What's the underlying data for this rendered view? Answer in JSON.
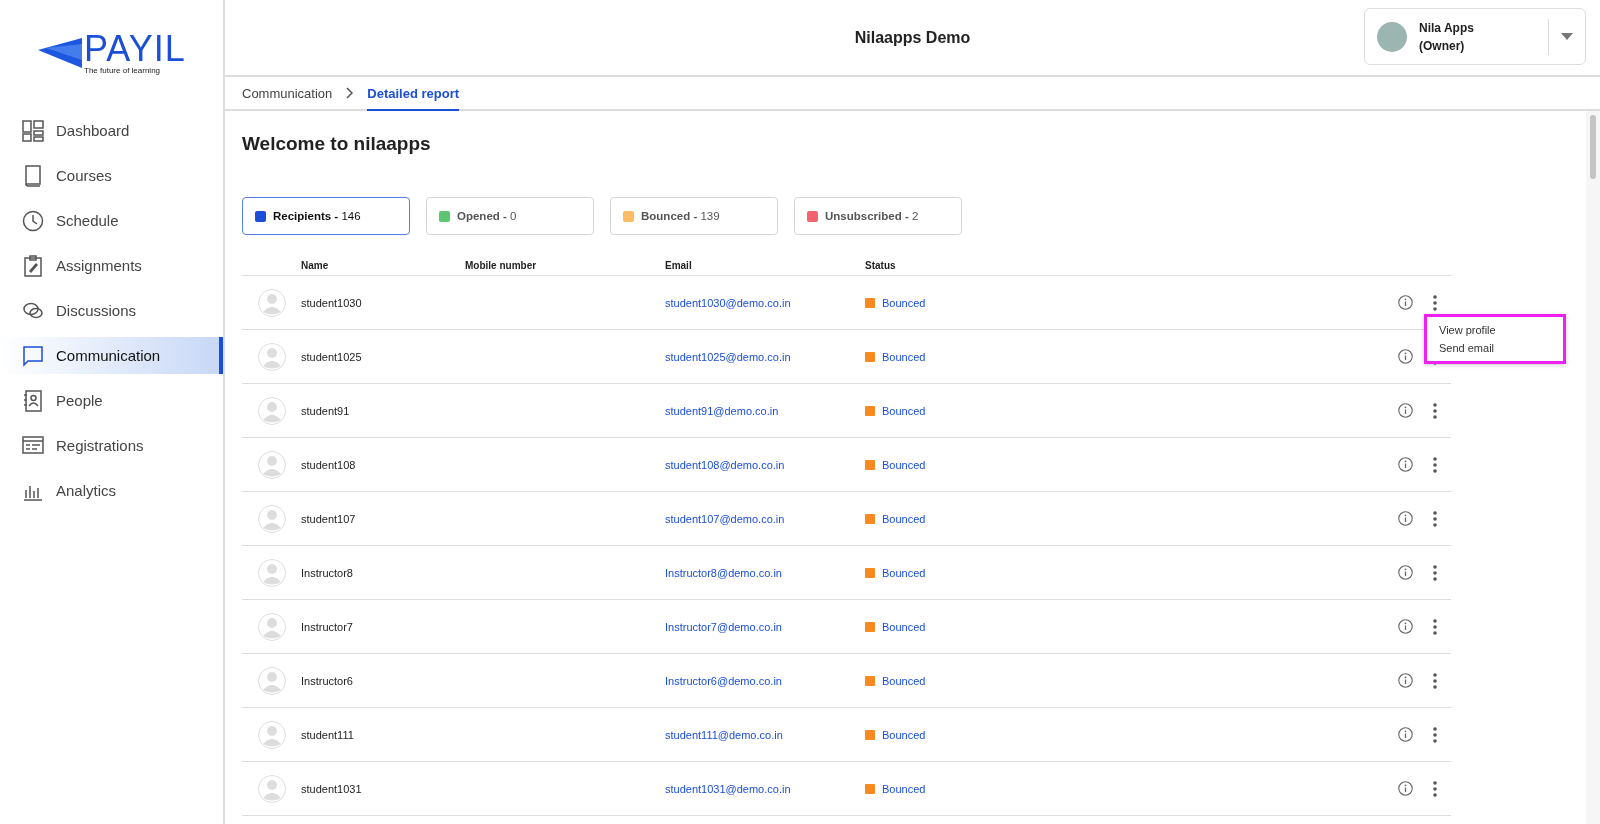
{
  "logo": {
    "name": "PAYIL",
    "tagline": "The future of learning"
  },
  "sidebar": {
    "items": [
      {
        "label": "Dashboard",
        "selected": false
      },
      {
        "label": "Courses",
        "selected": false
      },
      {
        "label": "Schedule",
        "selected": false
      },
      {
        "label": "Assignments",
        "selected": false
      },
      {
        "label": "Discussions",
        "selected": false
      },
      {
        "label": "Communication",
        "selected": true
      },
      {
        "label": "People",
        "selected": false
      },
      {
        "label": "Registrations",
        "selected": false
      },
      {
        "label": "Analytics",
        "selected": false
      }
    ]
  },
  "header": {
    "title": "Nilaapps Demo",
    "user": {
      "name": "Nila Apps",
      "role": "(Owner)"
    }
  },
  "breadcrumb": [
    {
      "label": "Communication",
      "selected": false
    },
    {
      "label": "Detailed report",
      "selected": true
    }
  ],
  "page_title": "Welcome to nilaapps",
  "filters": [
    {
      "label": "**Recipients -** 146",
      "color": "#1a4fd6",
      "selected": true
    },
    {
      "label": "**Opened -** 0",
      "color": "#5ec46e",
      "selected": false
    },
    {
      "label": "**Bounced -** 139",
      "color": "#fbbd63",
      "selected": false
    },
    {
      "label": "**Unsubscribed -** 2",
      "color": "#f3646f",
      "selected": false
    }
  ],
  "table": {
    "columns": [
      "Name",
      "Mobile number",
      "Email",
      "Status"
    ],
    "rows": [
      {
        "name": "student1030",
        "email": "student1030@demo.co.in",
        "status": "Bounced"
      },
      {
        "name": "student1025",
        "email": "student1025@demo.co.in",
        "status": "Bounced"
      },
      {
        "name": "student91",
        "email": "student91@demo.co.in",
        "status": "Bounced"
      },
      {
        "name": "student108",
        "email": "student108@demo.co.in",
        "status": "Bounced"
      },
      {
        "name": "student107",
        "email": "student107@demo.co.in",
        "status": "Bounced"
      },
      {
        "name": "Instructor8",
        "email": "Instructor8@demo.co.in",
        "status": "Bounced"
      },
      {
        "name": "Instructor7",
        "email": "Instructor7@demo.co.in",
        "status": "Bounced"
      },
      {
        "name": "Instructor6",
        "email": "Instructor6@demo.co.in",
        "status": "Bounced"
      },
      {
        "name": "student111",
        "email": "student111@demo.co.in",
        "status": "Bounced"
      },
      {
        "name": "student1031",
        "email": "student1031@demo.co.in",
        "status": "Bounced"
      }
    ]
  },
  "row_menu": {
    "items": [
      "View profile",
      "Send email"
    ]
  }
}
